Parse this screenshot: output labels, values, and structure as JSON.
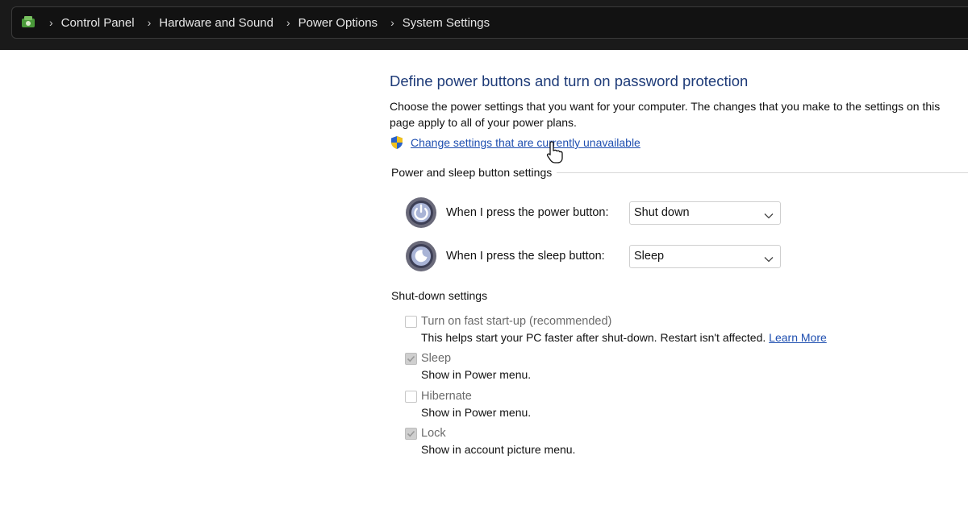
{
  "breadcrumb": {
    "icon": "control-panel-icon",
    "items": [
      "Control Panel",
      "Hardware and Sound",
      "Power Options",
      "System Settings"
    ]
  },
  "page": {
    "title": "Define power buttons and turn on password protection",
    "description": "Choose the power settings that you want for your computer. The changes that you make to the settings on this page apply to all of your power plans.",
    "admin_link": "Change settings that are currently unavailable"
  },
  "power_buttons": {
    "heading": "Power and sleep button settings",
    "power_label": "When I press the power button:",
    "power_value": "Shut down",
    "sleep_label": "When I press the sleep button:",
    "sleep_value": "Sleep"
  },
  "shutdown": {
    "heading": "Shut-down settings",
    "options": [
      {
        "label": "Turn on fast start-up (recommended)",
        "desc": "This helps start your PC faster after shut-down. Restart isn't affected.",
        "link": "Learn More",
        "checked": false
      },
      {
        "label": "Sleep",
        "desc": "Show in Power menu.",
        "checked": true
      },
      {
        "label": "Hibernate",
        "desc": "Show in Power menu.",
        "checked": false
      },
      {
        "label": "Lock",
        "desc": "Show in account picture menu.",
        "checked": true
      }
    ]
  },
  "colors": {
    "link": "#1f4fb0",
    "title": "#1e3b78",
    "topbar": "#1a1a1a"
  }
}
